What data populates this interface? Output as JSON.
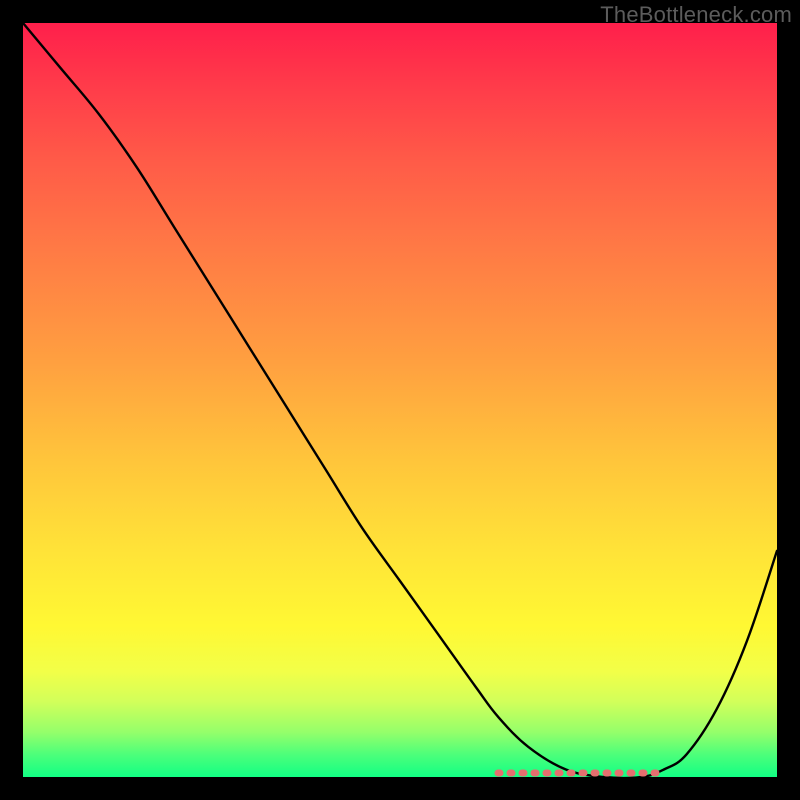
{
  "watermark": "TheBottleneck.com",
  "chart_data": {
    "type": "line",
    "title": "",
    "xlabel": "",
    "ylabel": "",
    "xlim": [
      0,
      100
    ],
    "ylim": [
      0,
      100
    ],
    "grid": false,
    "legend": false,
    "background_gradient": {
      "direction": "vertical",
      "stops": [
        {
          "pos": 0.0,
          "color": "#ff1f4b"
        },
        {
          "pos": 0.08,
          "color": "#ff3a4a"
        },
        {
          "pos": 0.18,
          "color": "#ff5a48"
        },
        {
          "pos": 0.3,
          "color": "#ff7a45"
        },
        {
          "pos": 0.45,
          "color": "#ffa040"
        },
        {
          "pos": 0.58,
          "color": "#ffc53b"
        },
        {
          "pos": 0.7,
          "color": "#ffe338"
        },
        {
          "pos": 0.8,
          "color": "#fff833"
        },
        {
          "pos": 0.86,
          "color": "#f2ff48"
        },
        {
          "pos": 0.9,
          "color": "#d2ff5a"
        },
        {
          "pos": 0.94,
          "color": "#96ff6a"
        },
        {
          "pos": 0.97,
          "color": "#4dff7a"
        },
        {
          "pos": 1.0,
          "color": "#12ff84"
        }
      ]
    },
    "series": [
      {
        "name": "bottleneck-curve",
        "color": "#000000",
        "x": [
          0,
          5,
          10,
          15,
          20,
          25,
          30,
          35,
          40,
          45,
          50,
          55,
          60,
          63,
          67,
          72,
          77,
          82,
          85,
          88,
          92,
          96,
          100
        ],
        "y": [
          100,
          94,
          88,
          81,
          73,
          65,
          57,
          49,
          41,
          33,
          26,
          19,
          12,
          8,
          4,
          1,
          0,
          0,
          1,
          3,
          9,
          18,
          30
        ]
      }
    ],
    "annotations": [
      {
        "name": "optimal-flat-region",
        "style": "dotted",
        "color": "#e46f6f",
        "x_range": [
          63,
          85
        ],
        "y": 0
      }
    ]
  }
}
